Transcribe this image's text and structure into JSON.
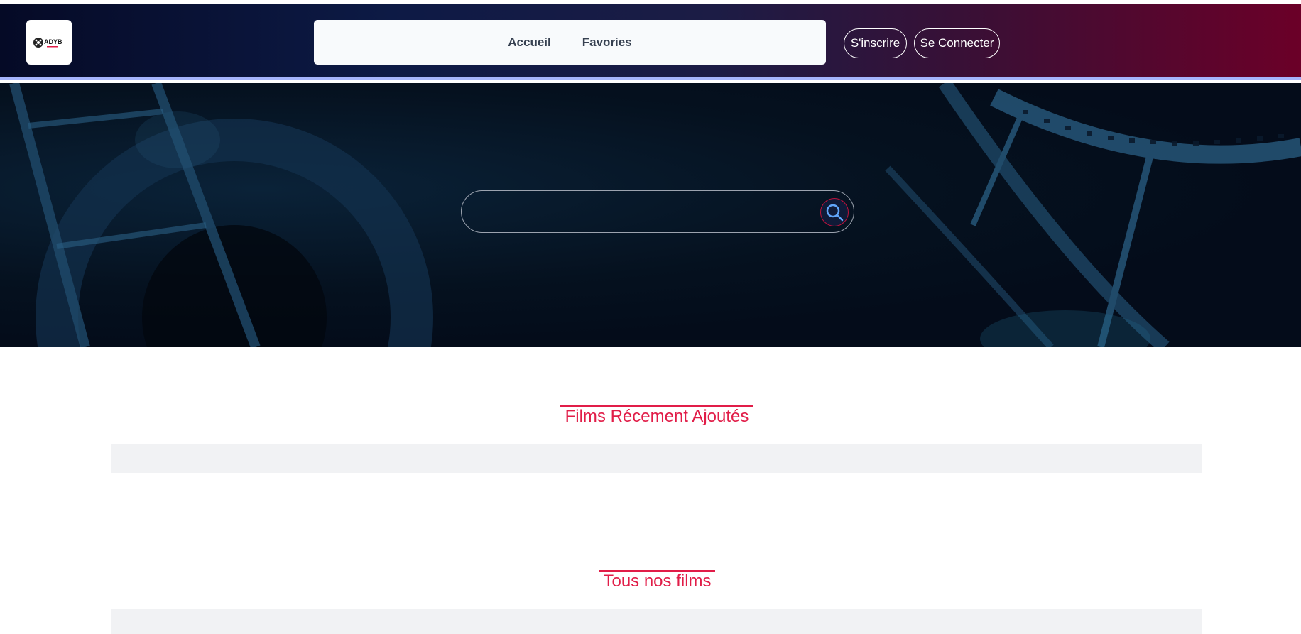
{
  "header": {
    "logo_text": "ADYB",
    "nav": [
      {
        "label": "Accueil"
      },
      {
        "label": "Favories"
      }
    ],
    "signup_label": "S'inscrire",
    "login_label": "Se Connecter"
  },
  "search": {
    "placeholder": "",
    "value": ""
  },
  "sections": {
    "recent_title": "Films Récement Ajoutés",
    "all_title": "Tous nos films"
  },
  "colors": {
    "accent": "#e11d48",
    "header_start": "#050a26",
    "header_end": "#6b0028",
    "header_border": "#a5b4fc"
  }
}
